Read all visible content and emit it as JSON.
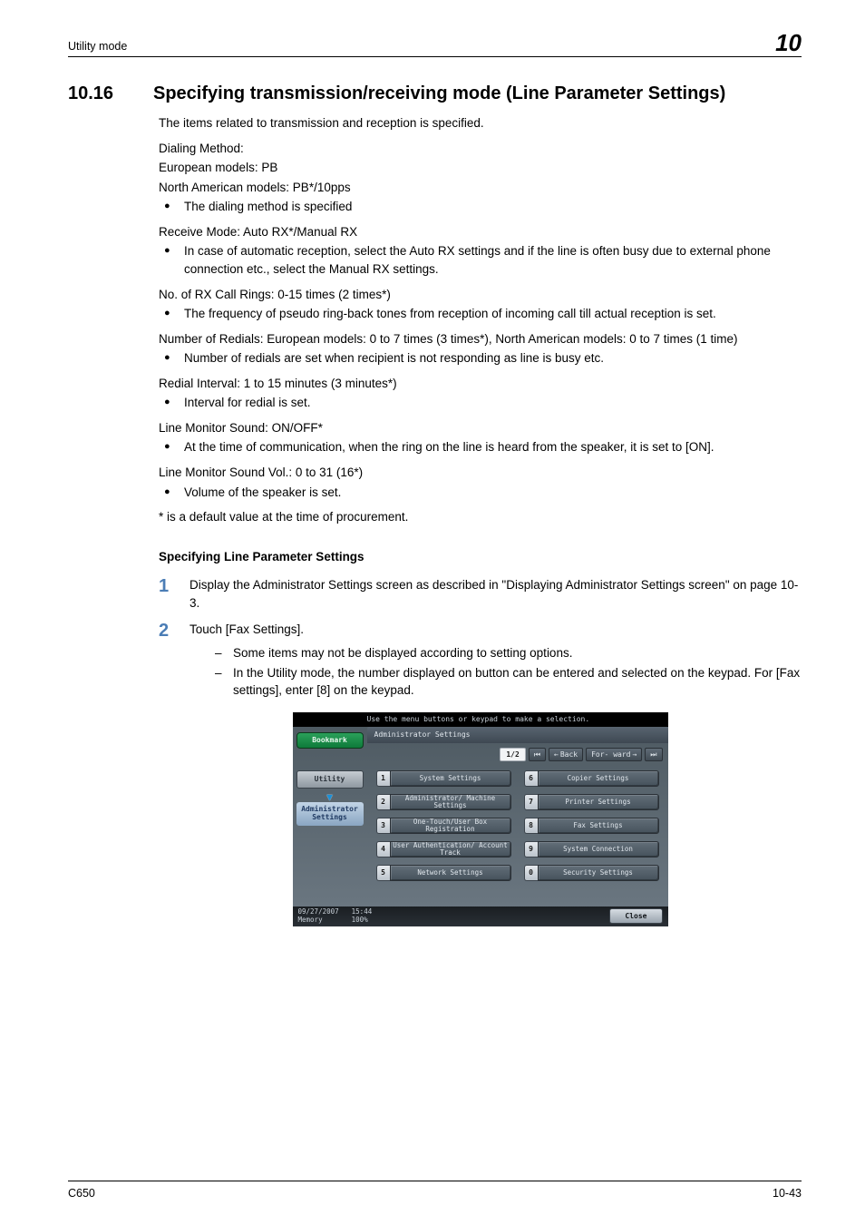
{
  "header": {
    "section": "Utility mode",
    "chapter": "10"
  },
  "footer": {
    "model": "C650",
    "pageno": "10-43"
  },
  "title": {
    "number": "10.16",
    "text": "Specifying transmission/receiving mode (Line Parameter Settings)"
  },
  "intro": "The items related to transmission and reception is specified.",
  "dialing_method": {
    "label": "Dialing Method:",
    "eu": "European models: PB",
    "na": "North American models: PB*/10pps",
    "bullet": "The dialing method is specified"
  },
  "receive_mode": {
    "label": "Receive Mode: Auto RX*/Manual RX",
    "bullet": "In case of automatic reception, select the Auto RX settings and if the line is often busy due to external phone connection etc., select the Manual RX settings."
  },
  "rx_rings": {
    "label": "No. of RX Call Rings: 0-15 times (2 times*)",
    "bullet": "The frequency of pseudo ring-back tones from reception of incoming call till actual reception is set."
  },
  "redials": {
    "label": "Number of Redials: European models: 0 to 7 times (3 times*), North American models: 0 to 7 times (1 time)",
    "bullet": "Number of redials are set when recipient is not responding as line is busy etc."
  },
  "redial_interval": {
    "label": "Redial Interval: 1 to 15 minutes (3 minutes*)",
    "bullet": "Interval for redial is set."
  },
  "line_monitor_sound": {
    "label": "Line Monitor Sound: ON/OFF*",
    "bullet": "At the time of communication, when the ring on the line is heard from the speaker, it is set to [ON]."
  },
  "line_monitor_vol": {
    "label": "Line Monitor Sound Vol.: 0 to 31 (16*)",
    "bullet": "Volume of the speaker is set."
  },
  "default_note": "* is a default value at the time of procurement.",
  "procedure": {
    "heading": "Specifying Line Parameter Settings",
    "step1": "Display the Administrator Settings screen as described in \"Displaying Administrator Settings screen\" on page 10-3.",
    "step2": {
      "text": "Touch [Fax Settings].",
      "note1": "Some items may not be displayed according to setting options.",
      "note2": "In the Utility mode, the number displayed on button can be entered and selected on the keypad. For [Fax settings], enter [8] on the keypad."
    }
  },
  "ui": {
    "hint": "Use the menu buttons or keypad to make a selection.",
    "title": "Administrator Settings",
    "bookmark": "Bookmark",
    "nav_utility": "Utility",
    "nav_admin": "Administrator Settings",
    "page": "1/2",
    "back": "Back",
    "forward": "For- ward",
    "menu": {
      "1": "System Settings",
      "2": "Administrator/ Machine Settings",
      "3": "One-Touch/User Box Registration",
      "4": "User Authentication/ Account Track",
      "5": "Network Settings",
      "6": "Copier Settings",
      "7": "Printer Settings",
      "8": "Fax Settings",
      "9": "System Connection",
      "0": "Security Settings"
    },
    "footer": {
      "date": "09/27/2007",
      "time": "15:44",
      "mem_label": "Memory",
      "mem_val": "100%",
      "close": "Close"
    }
  }
}
